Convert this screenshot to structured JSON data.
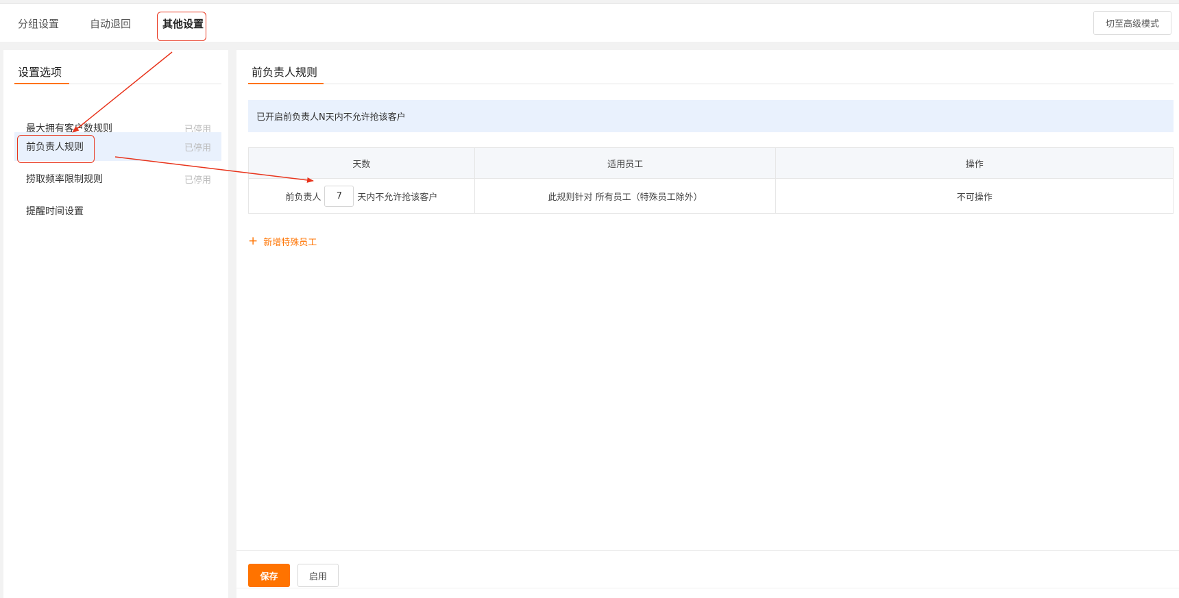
{
  "tabs": [
    {
      "label": "分组设置"
    },
    {
      "label": "自动退回"
    },
    {
      "label": "其他设置"
    }
  ],
  "advanced_mode_button": "切至高级模式",
  "settings_panel": {
    "title": "设置选项",
    "items": [
      {
        "label": "最大拥有客户数规则",
        "status": "已停用"
      },
      {
        "label": "前负责人规则",
        "status": "已停用"
      },
      {
        "label": "捞取频率限制规则",
        "status": "已停用"
      },
      {
        "label": "提醒时间设置",
        "status": ""
      }
    ]
  },
  "main": {
    "title": "前负责人规则",
    "info_text": "已开启前负责人N天内不允许抢该客户",
    "table": {
      "headers": [
        "天数",
        "适用员工",
        "操作"
      ],
      "row": {
        "prefix": "前负责人",
        "days_value": "7",
        "suffix": "天内不允许抢该客户",
        "applies_to": "此规则针对 所有员工（特殊员工除外）",
        "operation": "不可操作"
      }
    },
    "add_special_label": "新增特殊员工"
  },
  "footer": {
    "save_label": "保存",
    "enable_label": "启用"
  },
  "colors": {
    "accent": "#ff7300",
    "highlight_bg": "#e9f1fd",
    "annotation": "#e8341c"
  }
}
